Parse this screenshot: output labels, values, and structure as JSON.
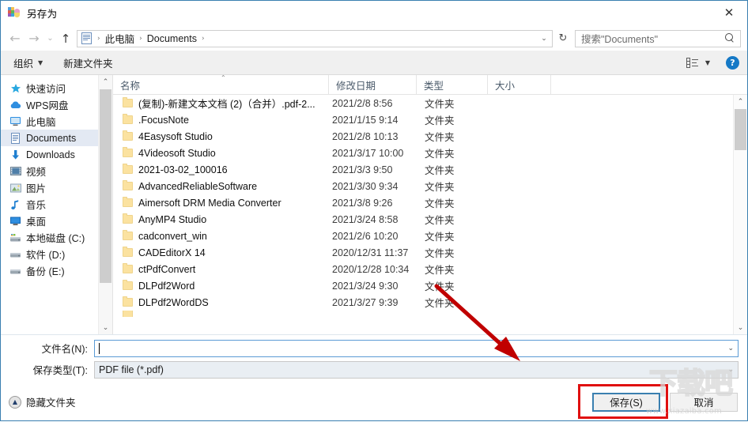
{
  "window": {
    "title": "另存为",
    "app_icon": "save-as-icon",
    "close_label": "✕"
  },
  "nav": {
    "back_icon": "←",
    "forward_icon": "→",
    "recent_icon": "⌄",
    "up_icon": "↑",
    "refresh_icon": "↻",
    "address_icon": "documents-folder-icon",
    "breadcrumbs": [
      "此电脑",
      "Documents"
    ],
    "separator": "›",
    "dropdown_icon": "⌄"
  },
  "search": {
    "placeholder": "搜索\"Documents\"",
    "icon": "search-icon"
  },
  "toolbar": {
    "organize_label": "组织",
    "organize_caret": "▼",
    "new_folder_label": "新建文件夹",
    "view_caret": "▼",
    "help_label": "?"
  },
  "sidebar": {
    "items": [
      {
        "label": "快速访问",
        "icon": "star-icon",
        "selected": false
      },
      {
        "label": "WPS网盘",
        "icon": "cloud-icon",
        "selected": false
      },
      {
        "label": "此电脑",
        "icon": "computer-icon",
        "selected": false
      },
      {
        "label": "Documents",
        "icon": "documents-icon",
        "selected": true
      },
      {
        "label": "Downloads",
        "icon": "download-icon",
        "selected": false
      },
      {
        "label": "视频",
        "icon": "video-icon",
        "selected": false
      },
      {
        "label": "图片",
        "icon": "picture-icon",
        "selected": false
      },
      {
        "label": "音乐",
        "icon": "music-icon",
        "selected": false
      },
      {
        "label": "桌面",
        "icon": "desktop-icon",
        "selected": false
      },
      {
        "label": "本地磁盘 (C:)",
        "icon": "system-drive-icon",
        "selected": false
      },
      {
        "label": "软件 (D:)",
        "icon": "drive-icon",
        "selected": false
      },
      {
        "label": "备份 (E:)",
        "icon": "drive-icon",
        "selected": false
      }
    ],
    "scroll_up_icon": "⌃",
    "scroll_down_icon": "⌄"
  },
  "filelist": {
    "columns": [
      "名称",
      "修改日期",
      "类型",
      "大小"
    ],
    "sort_indicator": "⌃",
    "rows": [
      {
        "name": "(复制)-新建文本文档 (2)（合并）.pdf-2...",
        "date": "2021/2/8 8:56",
        "type": "文件夹",
        "size": ""
      },
      {
        "name": ".FocusNote",
        "date": "2021/1/15 9:14",
        "type": "文件夹",
        "size": ""
      },
      {
        "name": "4Easysoft Studio",
        "date": "2021/2/8 10:13",
        "type": "文件夹",
        "size": ""
      },
      {
        "name": "4Videosoft Studio",
        "date": "2021/3/17 10:00",
        "type": "文件夹",
        "size": ""
      },
      {
        "name": "2021-03-02_100016",
        "date": "2021/3/3 9:50",
        "type": "文件夹",
        "size": ""
      },
      {
        "name": "AdvancedReliableSoftware",
        "date": "2021/3/30 9:34",
        "type": "文件夹",
        "size": ""
      },
      {
        "name": "Aimersoft DRM Media Converter",
        "date": "2021/3/8 9:26",
        "type": "文件夹",
        "size": ""
      },
      {
        "name": "AnyMP4 Studio",
        "date": "2021/3/24 8:58",
        "type": "文件夹",
        "size": ""
      },
      {
        "name": "cadconvert_win",
        "date": "2021/2/6 10:20",
        "type": "文件夹",
        "size": ""
      },
      {
        "name": "CADEditorX 14",
        "date": "2020/12/31 11:37",
        "type": "文件夹",
        "size": ""
      },
      {
        "name": "ctPdfConvert",
        "date": "2020/12/28 10:34",
        "type": "文件夹",
        "size": ""
      },
      {
        "name": "DLPdf2Word",
        "date": "2021/3/24 9:30",
        "type": "文件夹",
        "size": ""
      },
      {
        "name": "DLPdf2WordDS",
        "date": "2021/3/27 9:39",
        "type": "文件夹",
        "size": ""
      }
    ],
    "scroll_up_icon": "⌃",
    "scroll_down_icon": "⌄"
  },
  "form": {
    "filename_label": "文件名(N):",
    "filename_value": "",
    "filename_dropdown_icon": "⌄",
    "savetype_label": "保存类型(T):",
    "savetype_value": "PDF file (*.pdf)",
    "savetype_dropdown_icon": "⌄"
  },
  "footer": {
    "hide_folders_label": "隐藏文件夹",
    "hide_folders_icon": "▲",
    "save_label": "保存(S)",
    "cancel_label": "取消"
  },
  "annotation": {
    "arrow_color": "#c00000",
    "highlight_color": "#e01010"
  },
  "watermark": {
    "logo_text": "下载吧",
    "url": "www.xiazaiba.com"
  }
}
